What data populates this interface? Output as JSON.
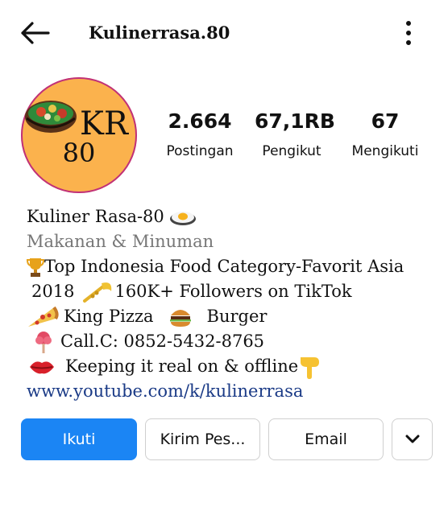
{
  "header": {
    "username": "Kulinerrasa.80",
    "back_icon": "arrow-left-icon",
    "more_icon": "more-vertical-icon"
  },
  "avatar": {
    "logo_text_line1": "KR",
    "logo_text_line2": "80",
    "ring_color": "#c0307a",
    "background_color": "#fbb24d"
  },
  "stats": {
    "posts": {
      "value": "2.664",
      "label": "Postingan"
    },
    "followers": {
      "value": "67,1RB",
      "label": "Pengikut"
    },
    "following": {
      "value": "67",
      "label": "Mengikuti"
    }
  },
  "bio": {
    "name": "Kuliner Rasa-80",
    "name_emoji": "fried-egg-icon",
    "category": "Makanan & Minuman",
    "line1_text": "Top Indonesia Food Category-Favorit Asia",
    "line1_emoji": "trophy-icon",
    "line2_year": "2018",
    "line2_emoji": "trumpet-icon",
    "line2_text": "160K+ Followers on TikTok",
    "line3_emoji1": "pizza-icon",
    "line3_text1": "King Pizza",
    "line3_emoji2": "hamburger-icon",
    "line3_text2": "Burger",
    "line4_emoji": "cotton-candy-icon",
    "line4_text": "Call.C: 0852-5432-8765",
    "line5_emoji": "lips-icon",
    "line5_text": "Keeping it real on & offline",
    "line5_end_emoji": "pointing-down-icon",
    "link": "www.youtube.com/k/kulinerrasa"
  },
  "actions": {
    "follow_label": "Ikuti",
    "message_label": "Kirim Pes...",
    "email_label": "Email",
    "more_icon": "chevron-down-icon"
  },
  "colors": {
    "accent": "#1b85f4",
    "link": "#1a3a86",
    "muted_text": "#777777"
  }
}
